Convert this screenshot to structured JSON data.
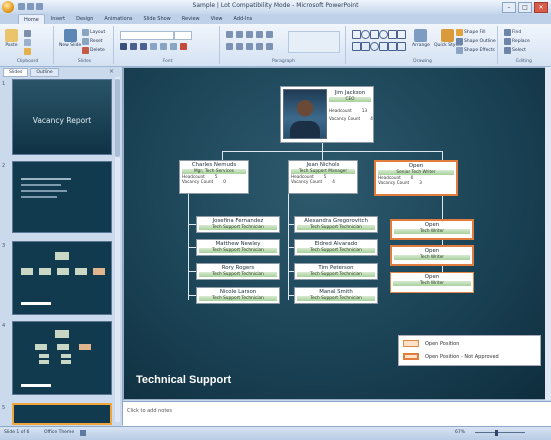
{
  "window": {
    "title": "Sample | Lot Compatibility Mode - Microsoft PowerPoint",
    "controls": [
      "–",
      "□",
      "✕"
    ]
  },
  "ribbon_tabs": [
    "Home",
    "Insert",
    "Design",
    "Animations",
    "Slide Show",
    "Review",
    "View",
    "Add-Ins"
  ],
  "ribbon_groups": [
    "Clipboard",
    "Slides",
    "Font",
    "Paragraph",
    "Drawing",
    "Editing"
  ],
  "ribbon_buttons": {
    "paste": "Paste",
    "new_slide": "New Slide",
    "layout": "Layout",
    "reset": "Reset",
    "delete": "Delete",
    "arrange": "Arrange",
    "quick_styles": "Quick Styles",
    "shape_fill": "Shape Fill",
    "shape_outline": "Shape Outline",
    "shape_effects": "Shape Effects",
    "find": "Find",
    "replace": "Replace",
    "select": "Select"
  },
  "panel": {
    "tabs": [
      "Slides",
      "Outline"
    ],
    "close": "×",
    "slide_numbers": [
      "1",
      "2",
      "3",
      "4",
      "5"
    ],
    "slide1_text": "Vacancy Report"
  },
  "org_chart": {
    "ceo": {
      "name": "Jim Jackson",
      "title": "CEO",
      "row1_label": "Headcount",
      "row1_value": "13",
      "row2_label": "Vacancy Count",
      "row2_value": "4"
    },
    "managers": [
      {
        "name": "Charles Nemuds",
        "title": "Mgr, Tech Services",
        "row1_label": "Headcount",
        "row1_value": "5",
        "row2_label": "Vacancy Count",
        "row2_value": "0"
      },
      {
        "name": "Jean Nichols",
        "title": "Tech Support Manager",
        "row1_label": "Headcount",
        "row1_value": "5",
        "row2_label": "Vacancy Count",
        "row2_value": "4"
      },
      {
        "name": "Open",
        "title": "Senior Tech Writer",
        "row1_label": "Headcount",
        "row1_value": "0",
        "row2_label": "Vacancy Count",
        "row2_value": "3"
      }
    ],
    "staff_left": [
      {
        "name": "Josefina Fernandez",
        "title": "Tech Support Technician"
      },
      {
        "name": "Matthew Newley",
        "title": "Tech Support Technician"
      },
      {
        "name": "Rory Rogers",
        "title": "Tech Support Technician"
      },
      {
        "name": "Nicole Larson",
        "title": "Tech Support Technician"
      }
    ],
    "staff_middle": [
      {
        "name": "Alexandra Gregorovitch",
        "title": "Tech Support Technician"
      },
      {
        "name": "Eldred Alvarado",
        "title": "Tech Support Technician"
      },
      {
        "name": "Tim Peterson",
        "title": "Tech Support Technician"
      },
      {
        "name": "Manal Smith",
        "title": "Tech Support Technician"
      }
    ],
    "staff_right": [
      {
        "name": "Open",
        "title": "Tech Writer"
      },
      {
        "name": "Open",
        "title": "Tech Writer"
      },
      {
        "name": "Open",
        "title": "Tech Writer"
      }
    ]
  },
  "legend": {
    "open": "Open Position",
    "open_not_approved": "Open Position - Not Approved"
  },
  "slide_title": "Technical Support",
  "notes_placeholder": "Click to add notes",
  "status": {
    "slide": "Slide 1 of 6",
    "theme": "Office Theme",
    "zoom": "67%"
  }
}
